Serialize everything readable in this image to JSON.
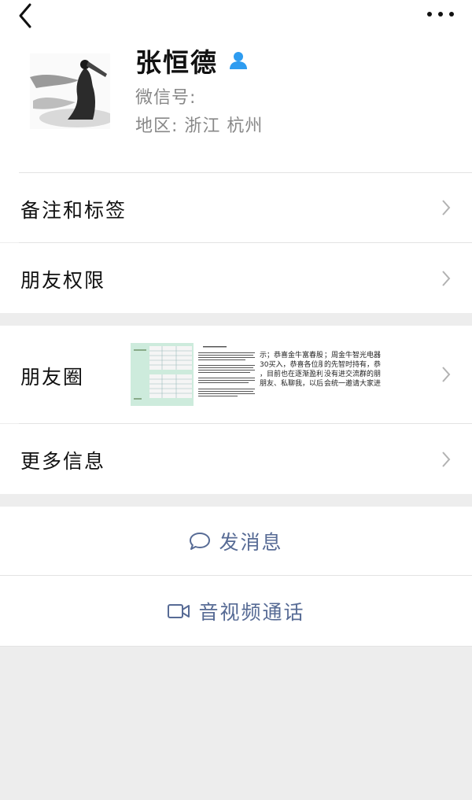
{
  "profile": {
    "name": "张恒德",
    "wechat_id_label": "微信号:",
    "region": "地区:  浙江  杭州"
  },
  "menu": {
    "remarks_tags": "备注和标签",
    "friend_permissions": "朋友权限",
    "moments": "朋友圈",
    "more_info": "更多信息"
  },
  "moments_thumbs": {
    "thumb3_lines": [
      "示；恭喜金牛富春股份",
      "30买入，恭喜各位朋",
      "，目前也在逐渐盈利，",
      "朋友、私聊我，以后"
    ],
    "thumb4_lines": [
      "；周金牛智光电器",
      "的先智时持有，恭",
      "没有进交流群的朋",
      "会统一邀请大家进"
    ]
  },
  "actions": {
    "send_message": "发消息",
    "video_call": "音视频通话"
  },
  "colors": {
    "link": "#576b95",
    "background": "#ededed",
    "contact_icon": "#2e9cf0"
  }
}
